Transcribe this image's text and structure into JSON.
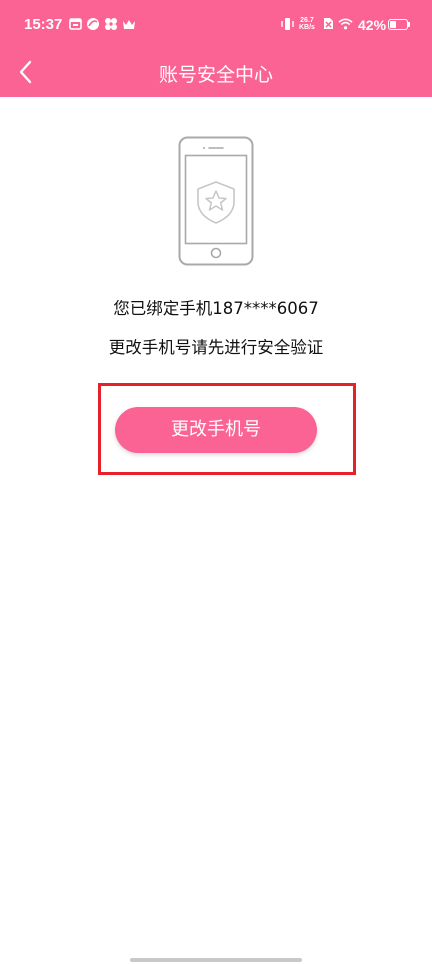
{
  "status_bar": {
    "time": "15:37",
    "network_speed_value": "26.7",
    "network_speed_unit": "KB/s",
    "battery_percent": "42%",
    "battery_level": 0.42,
    "icons": [
      "calendar-icon",
      "app-icon",
      "flower-icon",
      "crown-icon",
      "vibrate-icon",
      "speed-icon",
      "sim-off-icon",
      "wifi-icon",
      "battery-icon"
    ]
  },
  "nav": {
    "back_icon": "chevron-left-icon",
    "title": "账号安全中心"
  },
  "content": {
    "illustration_icon": "phone-shield-star-icon",
    "bound_prefix": "您已绑定手机",
    "masked_phone": "187****6067",
    "verify_notice": "更改手机号请先进行安全验证",
    "change_phone_button": "更改手机号"
  },
  "colors": {
    "brand": "#fb6394",
    "highlight": "#e5212a"
  }
}
